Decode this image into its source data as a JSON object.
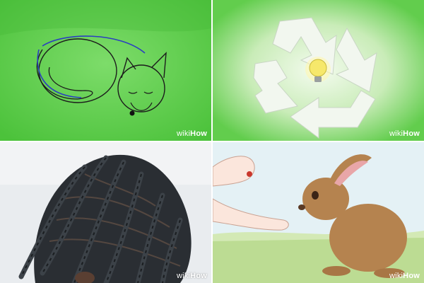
{
  "watermark": {
    "wiki": "wiki",
    "how": "How"
  },
  "colors": {
    "fox_bg": "#5ccf4a",
    "recycle_bg": "#6fd45a",
    "rabbit_sky": "#dff0f6",
    "rabbit_grass": "#b6d98a",
    "rabbit_fur": "#b5834f",
    "bulb": "#f6e86b",
    "braids": "#262a2e"
  },
  "tiles": [
    {
      "subject": "sleeping-fox-sketch"
    },
    {
      "subject": "recycle-symbol-with-lightbulb"
    },
    {
      "subject": "braided-hair-photo"
    },
    {
      "subject": "hand-feeding-rabbit"
    }
  ]
}
